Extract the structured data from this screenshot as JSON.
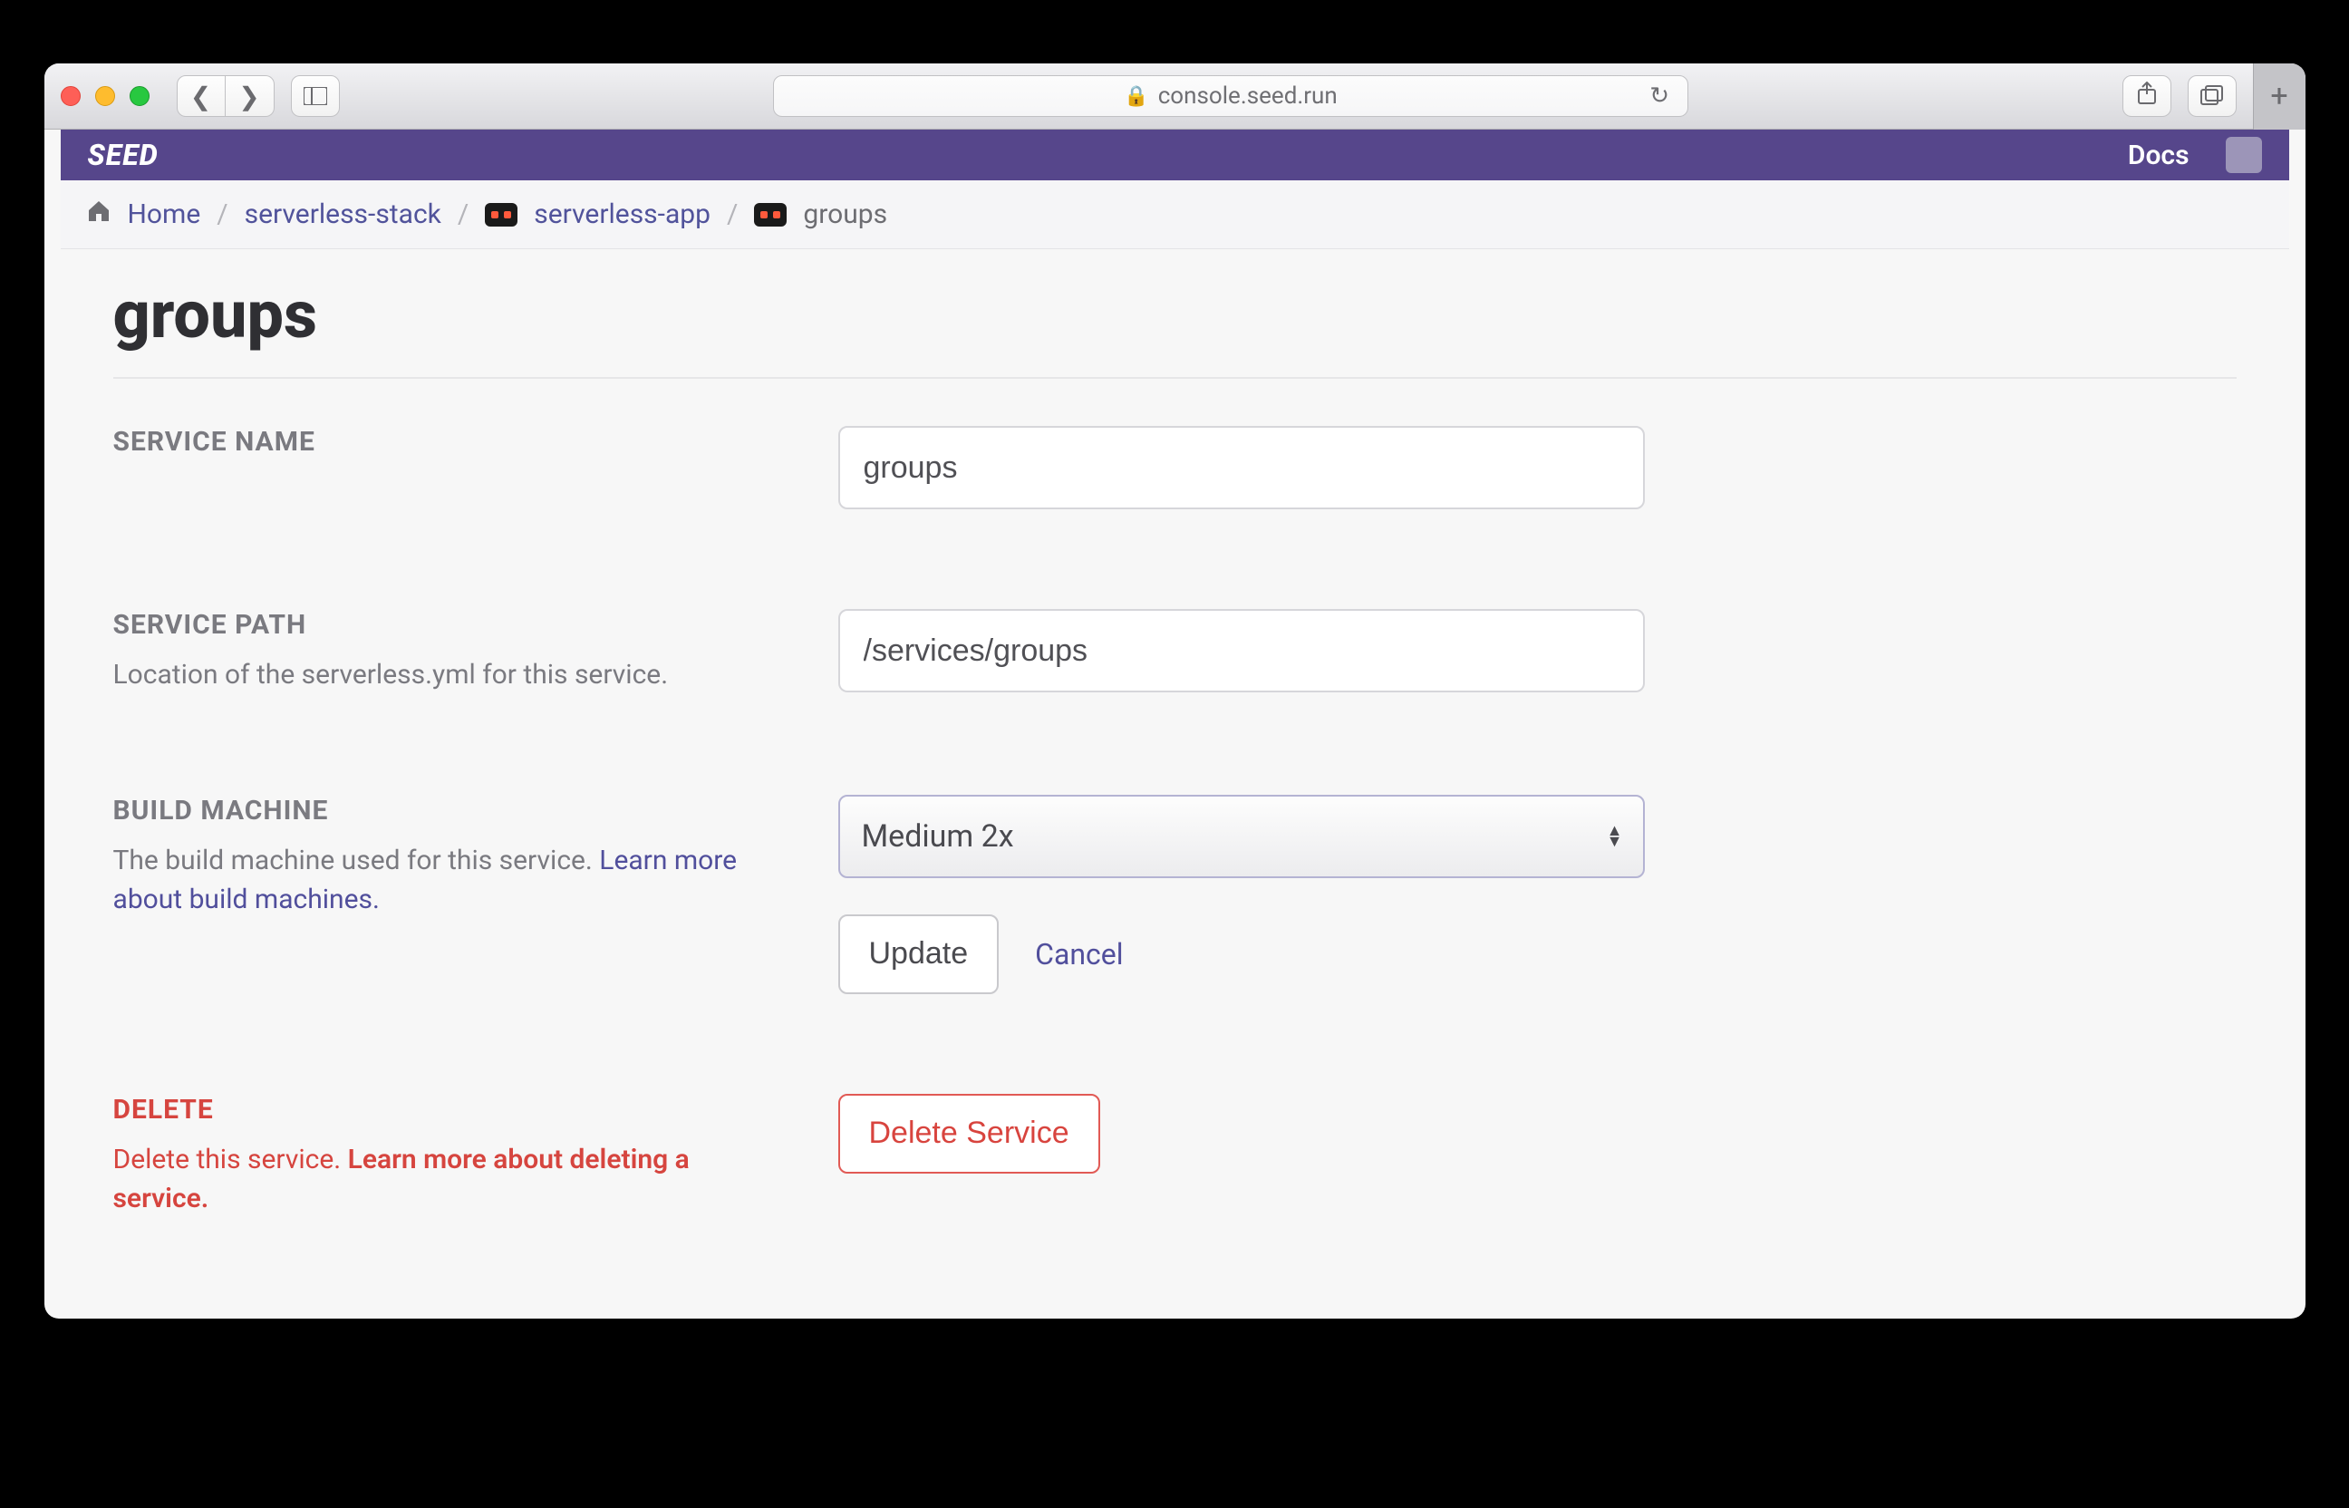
{
  "browser": {
    "url_host": "console.seed.run"
  },
  "header": {
    "brand": "SEED",
    "docs": "Docs"
  },
  "breadcrumb": {
    "home": "Home",
    "org": "serverless-stack",
    "app": "serverless-app",
    "current": "groups"
  },
  "page": {
    "title": "groups"
  },
  "serviceName": {
    "label": "SERVICE NAME",
    "value": "groups"
  },
  "servicePath": {
    "label": "SERVICE PATH",
    "desc": "Location of the serverless.yml for this service.",
    "value": "/services/groups"
  },
  "buildMachine": {
    "label": "BUILD MACHINE",
    "desc_prefix": "The build machine used for this service. ",
    "learn_more": "Learn more about build machines.",
    "selected": "Medium 2x",
    "update": "Update",
    "cancel": "Cancel"
  },
  "deleteSection": {
    "label": "DELETE",
    "desc_prefix": "Delete this service. ",
    "learn_more": "Learn more about deleting a service.",
    "button": "Delete Service"
  }
}
